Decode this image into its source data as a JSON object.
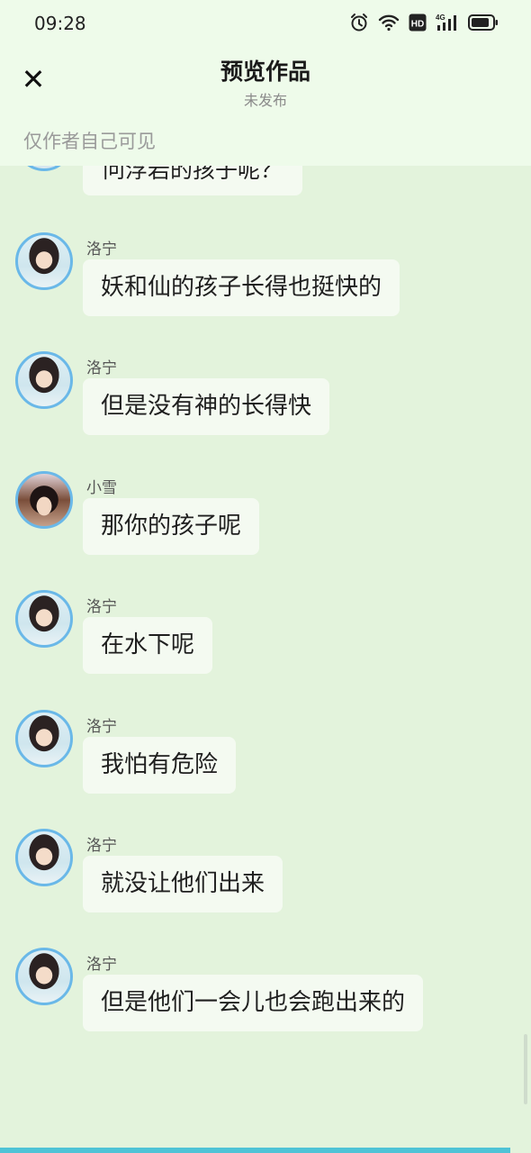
{
  "status_bar": {
    "time": "09:28",
    "icons": [
      "alarm-icon",
      "wifi-icon",
      "hd-icon",
      "4g-signal-icon",
      "battery-icon"
    ],
    "network_label": "4G",
    "hd_label": "HD"
  },
  "header": {
    "title": "预览作品",
    "subtitle": "未发布",
    "visibility_note": "仅作者自己可见",
    "close_icon": "✕"
  },
  "partial_message": {
    "text": "问浮岩的孩子呢？"
  },
  "messages": [
    {
      "sender": "洛宁",
      "text": "妖和仙的孩子长得也挺快的",
      "avatar": "luoning"
    },
    {
      "sender": "洛宁",
      "text": "但是没有神的长得快",
      "avatar": "luoning"
    },
    {
      "sender": "小雪",
      "text": "那你的孩子呢",
      "avatar": "xiaoxue"
    },
    {
      "sender": "洛宁",
      "text": "在水下呢",
      "avatar": "luoning"
    },
    {
      "sender": "洛宁",
      "text": "我怕有危险",
      "avatar": "luoning"
    },
    {
      "sender": "洛宁",
      "text": "就没让他们出来",
      "avatar": "luoning"
    },
    {
      "sender": "洛宁",
      "text": "但是他们一会儿也会跑出来的",
      "avatar": "luoning"
    }
  ],
  "colors": {
    "background": "#e3f3dc",
    "header": "#eefbea",
    "bubble": "#f4faf1",
    "avatar_ring": "#6ab8e8",
    "accent_bar": "#4fc3d6"
  }
}
